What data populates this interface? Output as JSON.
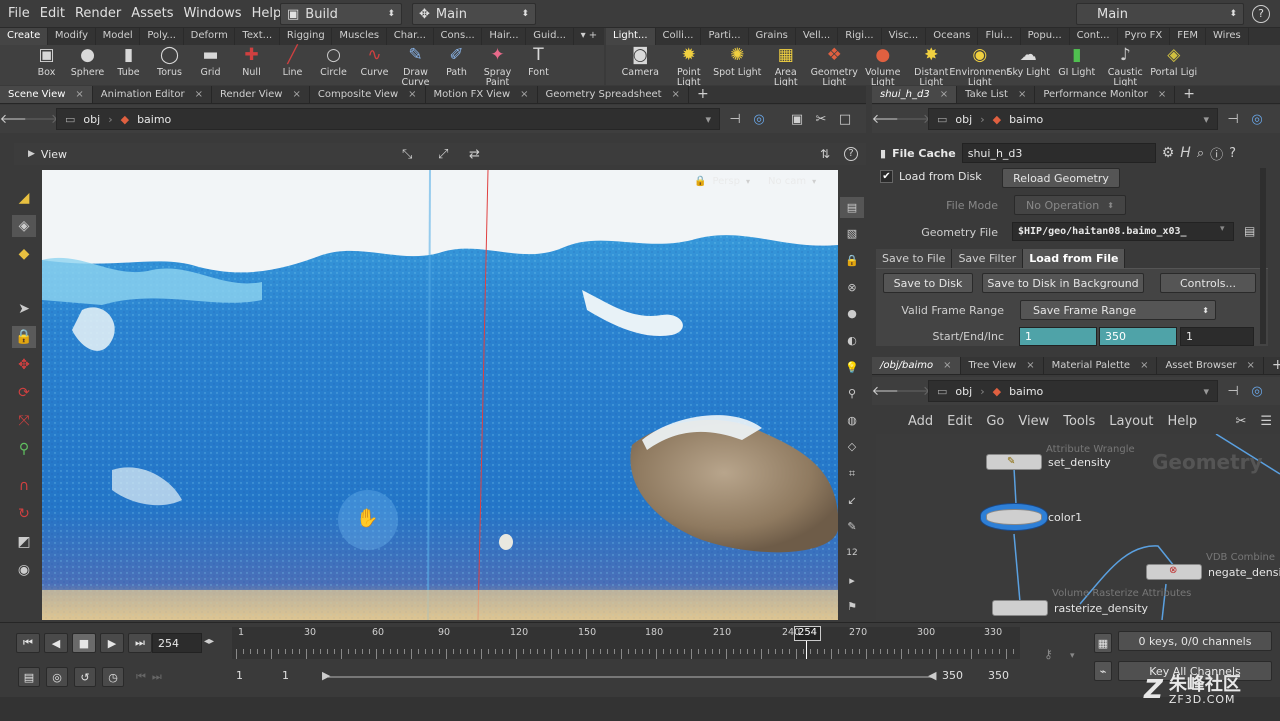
{
  "menu": [
    "File",
    "Edit",
    "Render",
    "Assets",
    "Windows",
    "Help"
  ],
  "desktop": {
    "build": "Build",
    "main": "Main",
    "right_main": "Main"
  },
  "shelf_tabs_left": [
    "Create",
    "Modify",
    "Model",
    "Poly...",
    "Deform",
    "Text...",
    "Rigging",
    "Muscles",
    "Char...",
    "Cons...",
    "Hair...",
    "Guid..."
  ],
  "shelf_tabs_right": [
    "Light...",
    "Colli...",
    "Parti...",
    "Grains",
    "Vell...",
    "Rigi...",
    "Visc...",
    "Oceans",
    "Flui...",
    "Popu...",
    "Cont...",
    "Pyro FX",
    "FEM",
    "Wires"
  ],
  "tools_left": [
    {
      "label": "Box",
      "icon": "box-icon"
    },
    {
      "label": "Sphere",
      "icon": "sphere-icon"
    },
    {
      "label": "Tube",
      "icon": "tube-icon"
    },
    {
      "label": "Torus",
      "icon": "torus-icon"
    },
    {
      "label": "Grid",
      "icon": "grid-icon"
    },
    {
      "label": "Null",
      "icon": "null-icon"
    },
    {
      "label": "Line",
      "icon": "line-icon"
    },
    {
      "label": "Circle",
      "icon": "circle-icon"
    },
    {
      "label": "Curve",
      "icon": "curve-icon"
    },
    {
      "label": "Draw Curve",
      "icon": "draw-curve-icon"
    },
    {
      "label": "Path",
      "icon": "path-icon"
    },
    {
      "label": "Spray Paint",
      "icon": "spray-paint-icon"
    },
    {
      "label": "Font",
      "icon": "font-icon"
    }
  ],
  "tools_right": [
    {
      "label": "Camera",
      "icon": "camera-icon"
    },
    {
      "label": "Point Light",
      "icon": "point-light-icon"
    },
    {
      "label": "Spot Light",
      "icon": "spot-light-icon"
    },
    {
      "label": "Area Light",
      "icon": "area-light-icon"
    },
    {
      "label": "Geometry Light",
      "icon": "geometry-light-icon"
    },
    {
      "label": "Volume Light",
      "icon": "volume-light-icon"
    },
    {
      "label": "Distant Light",
      "icon": "distant-light-icon"
    },
    {
      "label": "Environment Light",
      "icon": "environment-light-icon"
    },
    {
      "label": "Sky Light",
      "icon": "sky-light-icon"
    },
    {
      "label": "GI Light",
      "icon": "gi-light-icon"
    },
    {
      "label": "Caustic Light",
      "icon": "caustic-light-icon"
    },
    {
      "label": "Portal Ligi",
      "icon": "portal-light-icon"
    }
  ],
  "left_tabs": [
    "Scene View",
    "Animation Editor",
    "Render View",
    "Composite View",
    "Motion FX View",
    "Geometry Spreadsheet"
  ],
  "path": {
    "obj": "obj",
    "node": "baimo"
  },
  "viewport": {
    "title": "View",
    "persp": "Persp",
    "cam": "No cam"
  },
  "right_tabs": [
    "shui_h_d3",
    "Take List",
    "Performance Monitor"
  ],
  "filecache": {
    "type_label": "File Cache",
    "name": "shui_h_d3",
    "load_from_disk": "Load from Disk",
    "reload": "Reload Geometry",
    "file_mode_label": "File Mode",
    "file_mode": "No Operation",
    "geo_file_label": "Geometry File",
    "geo_file": "$HIP/geo/haitan08.baimo_x03_",
    "subtabs": [
      "Save to File",
      "Save Filter",
      "Load from File"
    ],
    "save_to_disk": "Save to Disk",
    "save_bg": "Save to Disk in Background",
    "controls": "Controls...",
    "valid_range_label": "Valid Frame Range",
    "valid_range": "Save Frame Range",
    "sei_label": "Start/End/Inc",
    "start": "1",
    "end": "350",
    "inc": "1"
  },
  "net_tabs": [
    "/obj/baimo",
    "Tree View",
    "Material Palette",
    "Asset Browser"
  ],
  "net_menu": [
    "Add",
    "Edit",
    "Go",
    "View",
    "Tools",
    "Layout",
    "Help"
  ],
  "net_watermark": "Geometry",
  "nodes": [
    {
      "sub": "Attribute Wrangle",
      "label": "set_density"
    },
    {
      "sub": "",
      "label": "color1"
    },
    {
      "sub": "VDB Combine",
      "label": "negate_densit"
    },
    {
      "sub": "Volume Rasterize Attributes",
      "label": "rasterize_density"
    }
  ],
  "timeline": {
    "frame": "254",
    "ticks": [
      "1",
      "30",
      "60",
      "90",
      "120",
      "150",
      "180",
      "210",
      "240",
      "270",
      "300",
      "330"
    ],
    "marker": "254",
    "range_start": "1",
    "range_start2": "1",
    "range_end": "350",
    "range_end2": "350",
    "keys": "0 keys, 0/0 channels",
    "key_all": "Key All Channels"
  },
  "watermark": {
    "text": "朱峰社区",
    "url": "ZF3D.COM"
  },
  "colors": {
    "accent": "#2a6fb5",
    "cache_field": "#4fa3a8",
    "node_selected": "#2e7fd6"
  }
}
